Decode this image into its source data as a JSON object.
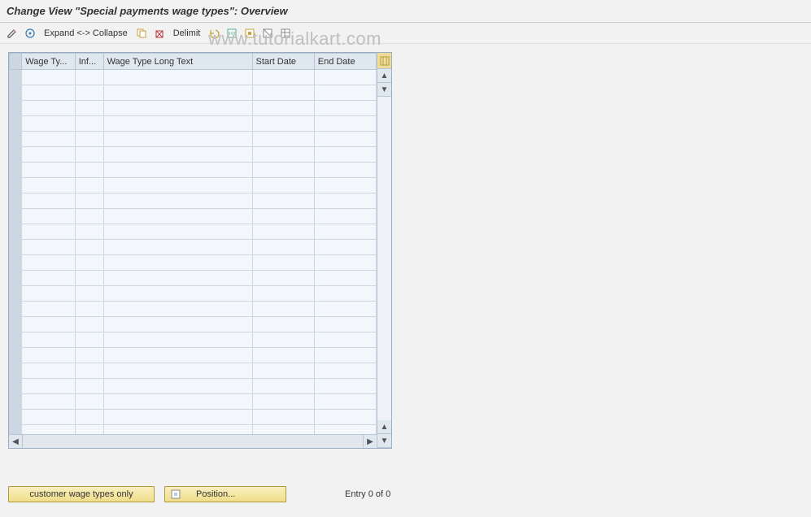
{
  "title": "Change View \"Special payments wage types\": Overview",
  "toolbar": {
    "expand_label": "Expand <-> Collapse",
    "delimit_label": "Delimit"
  },
  "table": {
    "columns": [
      "",
      "Wage Ty...",
      "Inf...",
      "Wage Type Long Text",
      "Start Date",
      "End Date"
    ],
    "row_count": 24
  },
  "footer": {
    "customer_btn": "customer wage types only",
    "position_btn": "Position...",
    "status": "Entry 0 of 0"
  },
  "watermark": "www.tutorialkart.com"
}
